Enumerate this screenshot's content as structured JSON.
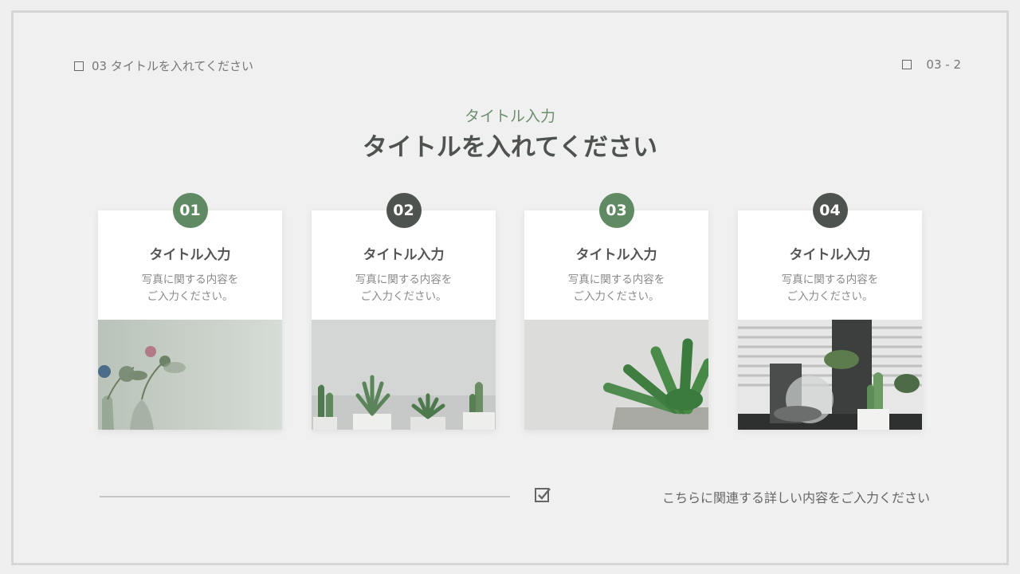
{
  "header": {
    "left_label": "03 タイトルを入れてください",
    "right_label": "03 - 2"
  },
  "heading": {
    "subtitle": "タイトル入力",
    "title": "タイトルを入れてください"
  },
  "cards": [
    {
      "number": "01",
      "title": "タイトル入力",
      "desc_line1": "写真に関する内容を",
      "desc_line2": "ご入力ください。",
      "badge_color": "#5f8a64"
    },
    {
      "number": "02",
      "title": "タイトル入力",
      "desc_line1": "写真に関する内容を",
      "desc_line2": "ご入力ください。",
      "badge_color": "#4e5350"
    },
    {
      "number": "03",
      "title": "タイトル入力",
      "desc_line1": "写真に関する内容を",
      "desc_line2": "ご入力ください。",
      "badge_color": "#5f8a64"
    },
    {
      "number": "04",
      "title": "タイトル入力",
      "desc_line1": "写真に関する内容を",
      "desc_line2": "ご入力ください。",
      "badge_color": "#4e5350"
    }
  ],
  "footer": {
    "text": "こちらに関連する詳しい内容をご入力ください"
  },
  "colors": {
    "accent_green": "#5f8a64",
    "accent_dark": "#4e5350",
    "subtitle_green": "#6d8d6f"
  },
  "icons": {
    "header_left": "square-icon",
    "header_right": "square-icon",
    "footer": "checkbox-checked-icon"
  }
}
